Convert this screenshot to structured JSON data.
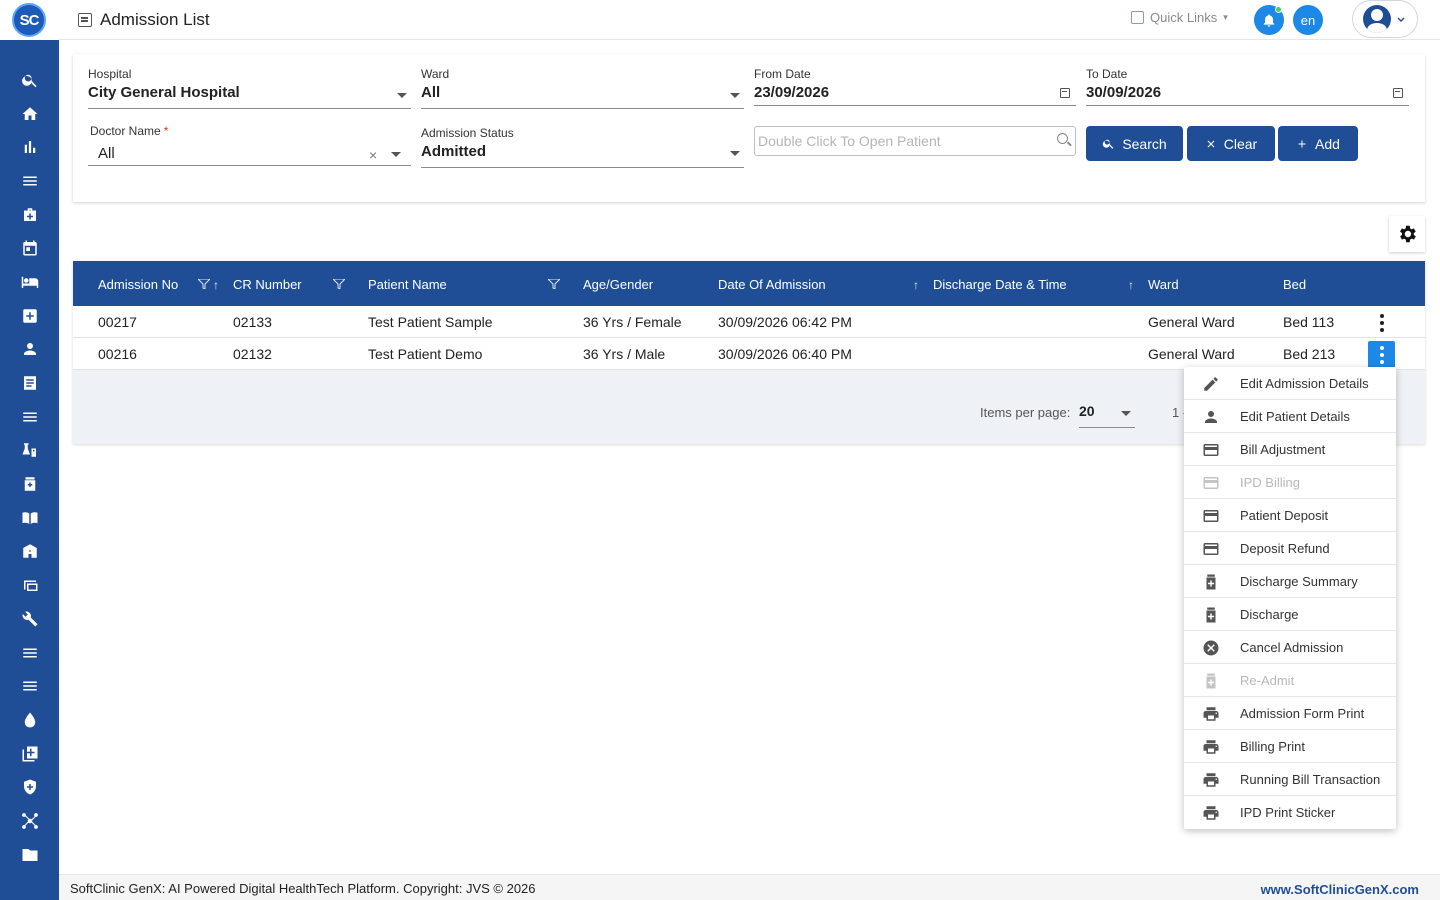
{
  "brand": {
    "logo_text": "SC"
  },
  "header": {
    "title": "Admission List",
    "quick_links": "Quick Links",
    "language": "en"
  },
  "sidebar": {
    "icons": [
      "search-icon",
      "home-icon",
      "bar-chart-icon",
      "menu-icon",
      "medical-bag-icon",
      "calendar-icon",
      "bed-icon",
      "hospital-plus-icon",
      "person-icon",
      "document-icon",
      "list-icon",
      "lab-icon",
      "medicine-icon",
      "book-icon",
      "building-icon",
      "devices-icon",
      "wrench-icon",
      "list-icon",
      "list-icon",
      "drop-icon",
      "add-box-icon",
      "shield-icon",
      "network-icon",
      "folder-icon"
    ]
  },
  "filters": {
    "hospital": {
      "label": "Hospital",
      "value": "City General Hospital"
    },
    "ward": {
      "label": "Ward",
      "value": "All"
    },
    "from_date": {
      "label": "From Date",
      "value": "23/09/2026"
    },
    "to_date": {
      "label": "To Date",
      "value": "30/09/2026"
    },
    "doctor": {
      "label": "Doctor Name",
      "required": "*",
      "value": "All"
    },
    "status": {
      "label": "Admission Status",
      "value": "Admitted"
    },
    "patient_search": {
      "placeholder": "Double Click To Open Patient"
    },
    "buttons": {
      "search": "Search",
      "clear": "Clear",
      "add": "Add"
    }
  },
  "table": {
    "columns": [
      "Admission No",
      "CR Number",
      "Patient Name",
      "Age/Gender",
      "Date Of Admission",
      "Discharge Date & Time",
      "Ward",
      "Bed"
    ],
    "rows": [
      {
        "admission_no": "00217",
        "cr_number": "02133",
        "patient_name": "Test Patient Sample",
        "age_gender": "36 Yrs / Female",
        "date_of_admission": "30/09/2026 06:42 PM",
        "discharge": "",
        "ward": "General Ward",
        "bed": "Bed 113"
      },
      {
        "admission_no": "00216",
        "cr_number": "02132",
        "patient_name": "Test Patient Demo",
        "age_gender": "36 Yrs / Male",
        "date_of_admission": "30/09/2026 06:40 PM",
        "discharge": "",
        "ward": "General Ward",
        "bed": "Bed 213"
      }
    ],
    "pager": {
      "items_per_page_label": "Items per page:",
      "items_per_page": "20",
      "range": "1 -"
    }
  },
  "context_menu": {
    "items": [
      {
        "label": "Edit Admission Details",
        "icon": "pencil-icon",
        "disabled": false
      },
      {
        "label": "Edit Patient Details",
        "icon": "person-icon",
        "disabled": false
      },
      {
        "label": "Bill Adjustment",
        "icon": "credit-card-icon",
        "disabled": false
      },
      {
        "label": "IPD Billing",
        "icon": "credit-card-icon",
        "disabled": true
      },
      {
        "label": "Patient Deposit",
        "icon": "credit-card-icon",
        "disabled": false
      },
      {
        "label": "Deposit Refund",
        "icon": "credit-card-icon",
        "disabled": false
      },
      {
        "label": "Discharge Summary",
        "icon": "medicine-bottle-icon",
        "disabled": false
      },
      {
        "label": "Discharge",
        "icon": "medicine-bottle-icon",
        "disabled": false
      },
      {
        "label": "Cancel Admission",
        "icon": "cancel-circle-icon",
        "disabled": false
      },
      {
        "label": "Re-Admit",
        "icon": "medicine-bottle-icon",
        "disabled": true
      },
      {
        "label": "Admission Form Print",
        "icon": "printer-icon",
        "disabled": false
      },
      {
        "label": "Billing Print",
        "icon": "printer-icon",
        "disabled": false
      },
      {
        "label": "Running Bill Transaction",
        "icon": "printer-icon",
        "disabled": false
      },
      {
        "label": "IPD Print Sticker",
        "icon": "printer-icon",
        "disabled": false
      }
    ]
  },
  "footer": {
    "copyright": "SoftClinic GenX: AI Powered Digital HealthTech Platform. Copyright: JVS © 2026",
    "website": "www.SoftClinicGenX.com"
  },
  "colors": {
    "primary": "#1f4e97",
    "accent": "#1d88e5",
    "required": "#e0342c"
  }
}
